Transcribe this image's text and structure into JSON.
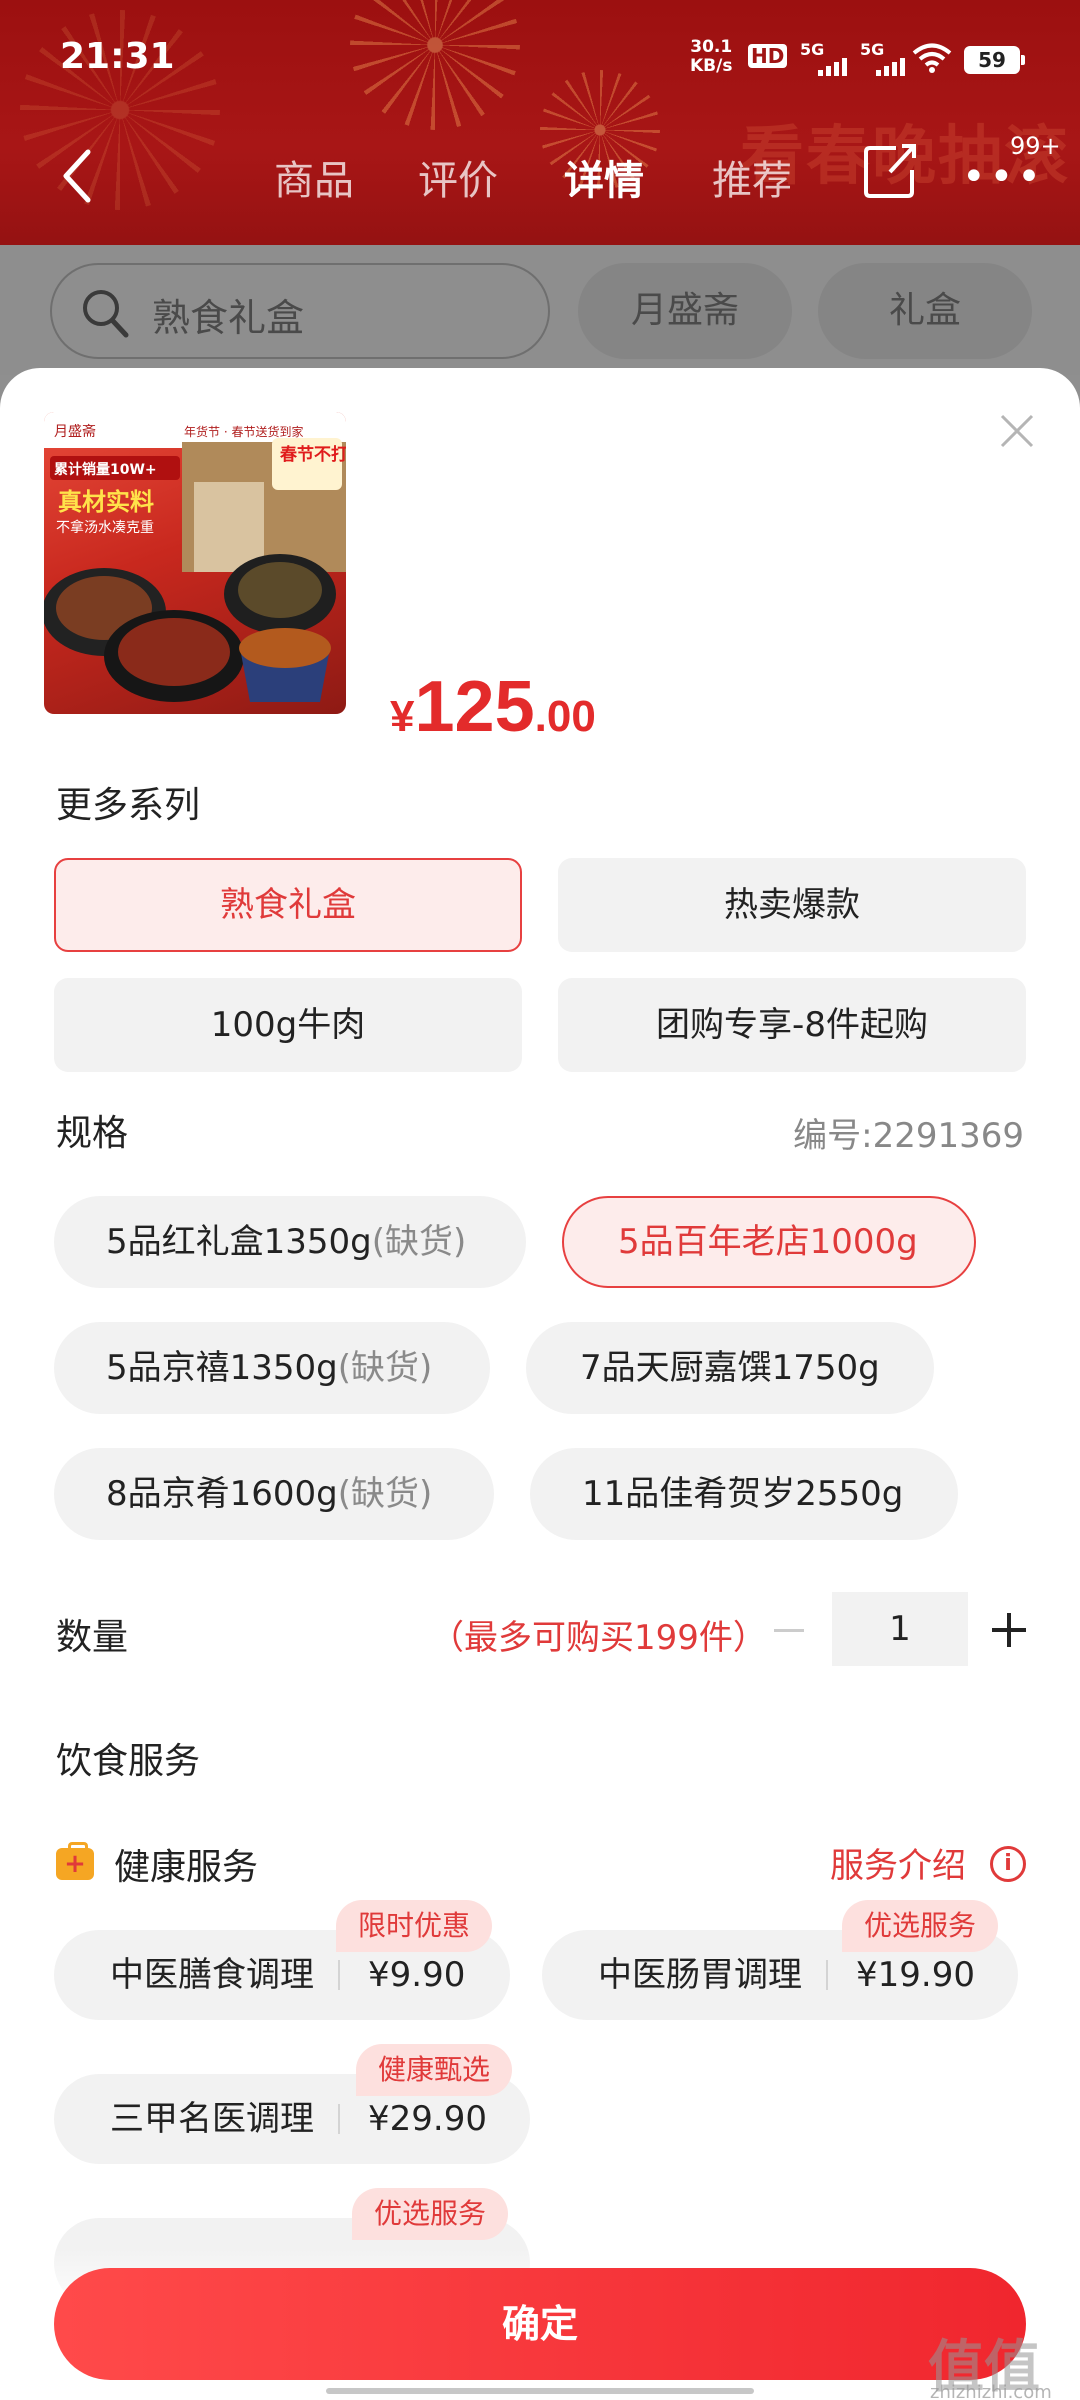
{
  "status_bar": {
    "time": "21:31",
    "net_speed_value": "30.1",
    "net_speed_unit": "KB/s",
    "hd_label": "HD",
    "sim1": "5G",
    "sim2": "5G",
    "battery": "59"
  },
  "nav": {
    "tabs": [
      "商品",
      "评价",
      "详情",
      "推荐"
    ],
    "active_tab": "详情",
    "more_badge": "99+",
    "banner_text": "看春晚抽滚"
  },
  "search": {
    "query": "熟食礼盒",
    "chips": [
      "月盛斋",
      "礼盒"
    ]
  },
  "product": {
    "image_text": {
      "brand": "月盛斋",
      "sales": "累计销量10W+",
      "headline": "真材实料",
      "subline": "不拿汤水凑克重",
      "festival": "年货节 · 春节送货到家",
      "corner": "春节不打烊"
    },
    "price_symbol": "¥",
    "price_int": "125",
    "price_dec": ".00"
  },
  "series": {
    "title": "更多系列",
    "options": [
      "熟食礼盒",
      "热卖爆款",
      "100g牛肉",
      "团购专享-8件起购"
    ],
    "selected_index": 0
  },
  "spec": {
    "title": "规格",
    "code": "编号:2291369",
    "options": [
      {
        "label": "5品红礼盒1350g",
        "note": "(缺货)"
      },
      {
        "label": "5品百年老店1000g",
        "note": ""
      },
      {
        "label": "5品京禧1350g",
        "note": "(缺货)"
      },
      {
        "label": "7品天厨嘉馔1750g",
        "note": ""
      },
      {
        "label": "8品京肴1600g",
        "note": "(缺货)"
      },
      {
        "label": "11品佳肴贺岁2550g",
        "note": ""
      }
    ],
    "selected_index": 1
  },
  "quantity": {
    "title": "数量",
    "limit_note": "（最多可购买199件）",
    "value": "1"
  },
  "diet_service": {
    "title": "饮食服务",
    "health_title": "健康服务",
    "intro_link": "服务介绍",
    "services": [
      {
        "name": "中医膳食调理",
        "price": "¥9.90",
        "tag": "限时优惠"
      },
      {
        "name": "中医肠胃调理",
        "price": "¥19.90",
        "tag": "优选服务"
      },
      {
        "name": "三甲名医调理",
        "price": "¥29.90",
        "tag": "健康甄选"
      },
      {
        "name": "",
        "price": "",
        "tag": "优选服务"
      }
    ]
  },
  "confirm_label": "确定",
  "watermark": {
    "main": "值值值",
    "sub": "zhizhizhi.com"
  },
  "colors": {
    "accent": "#e32b2b",
    "header": "#a81616",
    "chip_bg": "#f2f2f2",
    "selected_bg": "#fdeceb"
  }
}
